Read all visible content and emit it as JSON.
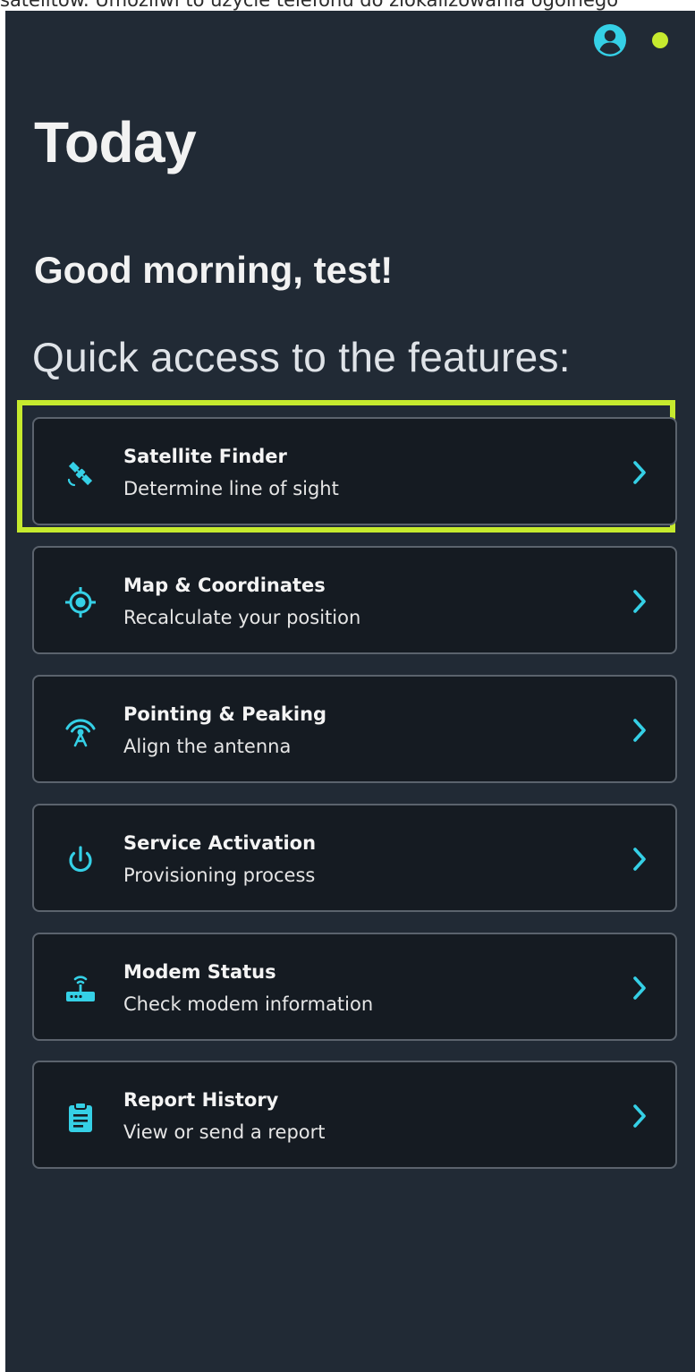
{
  "caption": "satelitów. Umożliwi to użycie telefonu do zlokalizowania ogólnego",
  "colors": {
    "background": "#212a35",
    "card_background": "#151b22",
    "card_border": "#5b636d",
    "accent": "#35d0e6",
    "status_dot": "#c6ea2e",
    "highlight": "#c6ea2e"
  },
  "header": {
    "account_icon": "account-circle-icon",
    "status_icon": "status-dot-icon"
  },
  "page": {
    "title": "Today",
    "greeting": "Good morning, test!",
    "quick_access": "Quick access to the features:"
  },
  "features": [
    {
      "title": "Satellite Finder",
      "subtitle": "Determine line of sight",
      "icon": "satellite-icon",
      "highlighted": true
    },
    {
      "title": "Map & Coordinates",
      "subtitle": "Recalculate your position",
      "icon": "gps-target-icon",
      "highlighted": false
    },
    {
      "title": "Pointing & Peaking",
      "subtitle": "Align the antenna",
      "icon": "antenna-icon",
      "highlighted": false
    },
    {
      "title": "Service Activation",
      "subtitle": "Provisioning process",
      "icon": "power-icon",
      "highlighted": false
    },
    {
      "title": "Modem Status",
      "subtitle": "Check modem information",
      "icon": "router-icon",
      "highlighted": false
    },
    {
      "title": "Report History",
      "subtitle": "View or send a report",
      "icon": "clipboard-icon",
      "highlighted": false
    }
  ]
}
